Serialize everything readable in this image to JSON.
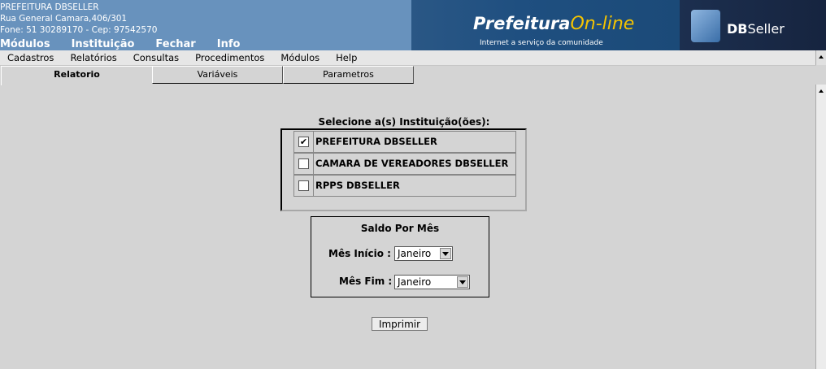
{
  "header": {
    "institution_name": "PREFEITURA DBSELLER",
    "address": "Rua General Camara,406/301",
    "contact": "Fone: 51 30289170  -  Cep: 97542570",
    "top_menu": [
      "Módulos",
      "Instituição",
      "Fechar",
      "Info"
    ],
    "banner_brand": "Prefeitura",
    "banner_brand_suffix": "On-line",
    "banner_tagline": "Internet a serviço da comunidade",
    "vendor_logo_bold": "DB",
    "vendor_logo_rest": "Seller"
  },
  "menubar": [
    "Cadastros",
    "Relatórios",
    "Consultas",
    "Procedimentos",
    "Módulos",
    "Help"
  ],
  "tabs": [
    {
      "label": "Relatorio",
      "active": true
    },
    {
      "label": "Variáveis",
      "active": false
    },
    {
      "label": "Parametros",
      "active": false
    }
  ],
  "institutions": {
    "title": "Selecione a(s) Instituição(ões):",
    "items": [
      {
        "label": "PREFEITURA DBSELLER",
        "checked": true
      },
      {
        "label": "CAMARA DE VEREADORES DBSELLER",
        "checked": false
      },
      {
        "label": "RPPS DBSELLER",
        "checked": false
      }
    ]
  },
  "saldo": {
    "title": "Saldo Por Mês",
    "mes_inicio_label": "Mês Início :",
    "mes_inicio_value": "Janeiro",
    "mes_fim_label": "Mês Fim :",
    "mes_fim_value": "Janeiro"
  },
  "print_button": "Imprimir",
  "colors": {
    "header_bg": "#6892bd",
    "panel_bg": "#d4d4d4",
    "banner_accent": "#f5c400"
  }
}
